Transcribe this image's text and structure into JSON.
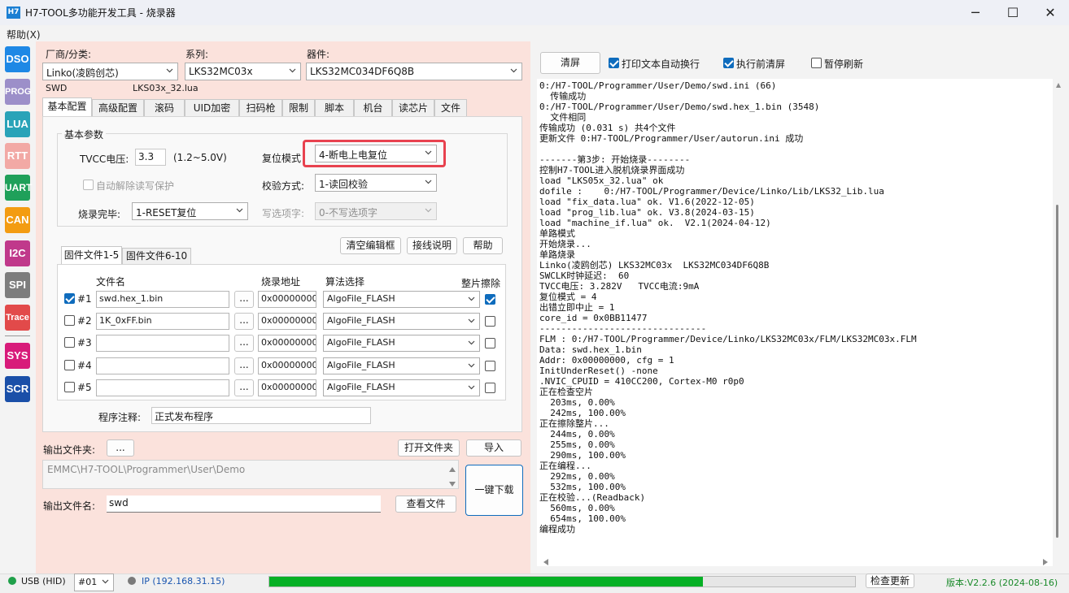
{
  "window": {
    "logo_text": "H7",
    "title": "H7-TOOL多功能开发工具 - 烧录器",
    "controls": {
      "minimize": "─",
      "maximize": "☐",
      "close": "✕"
    }
  },
  "menu": {
    "help": "帮助(X)"
  },
  "sidebar": {
    "items": [
      {
        "label": "DSO",
        "color": "#1e88e5"
      },
      {
        "label": "PROG",
        "color": "#9c8fc9"
      },
      {
        "label": "LUA",
        "color": "#29a3b8"
      },
      {
        "label": "RTT",
        "color": "#f2a9a5"
      },
      {
        "label": "UART",
        "color": "#1fa05a"
      },
      {
        "label": "CAN",
        "color": "#f39c12"
      },
      {
        "label": "I2C",
        "color": "#c0398b"
      },
      {
        "label": "SPI",
        "color": "#7d7d7d"
      },
      {
        "label": "Trace",
        "color": "#e24a4a"
      },
      {
        "label": "SYS",
        "color": "#d81b7a"
      },
      {
        "label": "SCR",
        "color": "#1a4fa8"
      }
    ]
  },
  "device": {
    "vendor_label": "厂商/分类:",
    "vendor_value": "Linko(凌鸥创芯)",
    "series_label": "系列:",
    "series_value": "LKS32MC03x",
    "part_label": "器件:",
    "part_value": "LKS32MC034DF6Q8B",
    "interface": "SWD",
    "lua_file": "LKS03x_32.lua"
  },
  "tabs": [
    "基本配置",
    "高级配置",
    "滚码",
    "UID加密",
    "扫码枪",
    "限制",
    "脚本",
    "机台",
    "读芯片",
    "文件"
  ],
  "basic": {
    "group_title": "基本参数",
    "tvcc_label": "TVCC电压:",
    "tvcc_value": "3.3",
    "tvcc_range": "(1.2~5.0V)",
    "reset_label": "复位模式",
    "reset_value": "4-断电上电复位",
    "auto_unlock_label": "自动解除读写保护",
    "verify_label": "校验方式:",
    "verify_value": "1-读回校验",
    "finish_label": "烧录完毕:",
    "finish_value": "1-RESET复位",
    "option_label": "写选项字:",
    "option_value": "0-不写选项字"
  },
  "firmware": {
    "btn_clear": "清空编辑框",
    "btn_wiring": "接线说明",
    "btn_help": "帮助",
    "subtabs": [
      "固件文件1-5",
      "固件文件6-10"
    ],
    "headers": {
      "file": "文件名",
      "addr": "烧录地址",
      "algo": "算法选择",
      "erase": "整片擦除"
    },
    "browse": "...",
    "rows": [
      {
        "id": "#1",
        "checked": true,
        "file": "swd.hex_1.bin",
        "addr": "0x00000000",
        "algo": "AlgoFile_FLASH",
        "erase": true
      },
      {
        "id": "#2",
        "checked": false,
        "file": "1K_0xFF.bin",
        "addr": "0x00000000",
        "algo": "AlgoFile_FLASH",
        "erase": false
      },
      {
        "id": "#3",
        "checked": false,
        "file": "",
        "addr": "0x00000000",
        "algo": "AlgoFile_FLASH",
        "erase": false
      },
      {
        "id": "#4",
        "checked": false,
        "file": "",
        "addr": "0x00000000",
        "algo": "AlgoFile_FLASH",
        "erase": false
      },
      {
        "id": "#5",
        "checked": false,
        "file": "",
        "addr": "0x00000000",
        "algo": "AlgoFile_FLASH",
        "erase": false
      }
    ],
    "note_label": "程序注释:",
    "note_value": "正式发布程序"
  },
  "output": {
    "folder_label": "输出文件夹:",
    "browse": "...",
    "open_folder": "打开文件夹",
    "import": "导入",
    "path": "EMMC\\H7-TOOL\\Programmer\\User\\Demo",
    "download": "一键下载",
    "name_label": "输出文件名:",
    "name_value": "swd",
    "view_file": "查看文件"
  },
  "console": {
    "clear": "清屏",
    "opt_wrap": "打印文本自动换行",
    "opt_wrap_checked": true,
    "opt_clear_before": "执行前清屏",
    "opt_clear_before_checked": true,
    "opt_pause": "暂停刷新",
    "opt_pause_checked": false,
    "log": "0:/H7-TOOL/Programmer/User/Demo/swd.ini (66)\n  传输成功\n0:/H7-TOOL/Programmer/User/Demo/swd.hex_1.bin (3548)\n  文件相同\n传输成功 (0.031 s) 共4个文件\n更新文件 0:H7-TOOL/Programmer/User/autorun.ini 成功\n\n-------第3步: 开始烧录--------\n控制H7-TOOL进入脱机烧录界面成功\nload \"LKS05x_32.lua\" ok\ndofile :    0:/H7-TOOL/Programmer/Device/Linko/Lib/LKS32_Lib.lua\nload \"fix_data.lua\" ok. V1.6(2022-12-05)\nload \"prog_lib.lua\" ok. V3.8(2024-03-15)\nload \"machine_if.lua\" ok.  V2.1(2024-04-12)\n单路模式\n开始烧录...\n单路烧录\nLinko(凌鸥创芯) LKS32MC03x  LKS32MC034DF6Q8B\nSWCLK时钟延迟:  60\nTVCC电压: 3.282V   TVCC电流:9mA\n复位模式 = 4\n出错立即中止 = 1\ncore_id = 0x0BB11477\n-------------------------------\nFLM : 0:/H7-TOOL/Programmer/Device/Linko/LKS32MC03x/FLM/LKS32MC03x.FLM\nData: swd.hex_1.bin\nAddr: 0x00000000, cfg = 1\nInitUnderReset() -none\n.NVIC_CPUID = 410CC200, Cortex-M0 r0p0\n正在检查空片\n  203ms, 0.00%\n  242ms, 100.00%\n正在擦除整片...\n  244ms, 0.00%\n  255ms, 0.00%\n  290ms, 100.00%\n正在编程...\n  292ms, 0.00%\n  532ms, 100.00%\n正在校验...(Readback)\n  560ms, 0.00%\n  654ms, 100.00%\n编程成功"
  },
  "status": {
    "usb": "USB (HID)",
    "usb_color": "#1fa04a",
    "device_no": "#01",
    "ip": "IP (192.168.31.15)",
    "ip_color": "#7a7a7a",
    "progress": 0.74,
    "check_update": "检查更新",
    "version": "版本:V2.2.6 (2024-08-16)",
    "version_color": "#1a8a2a"
  }
}
